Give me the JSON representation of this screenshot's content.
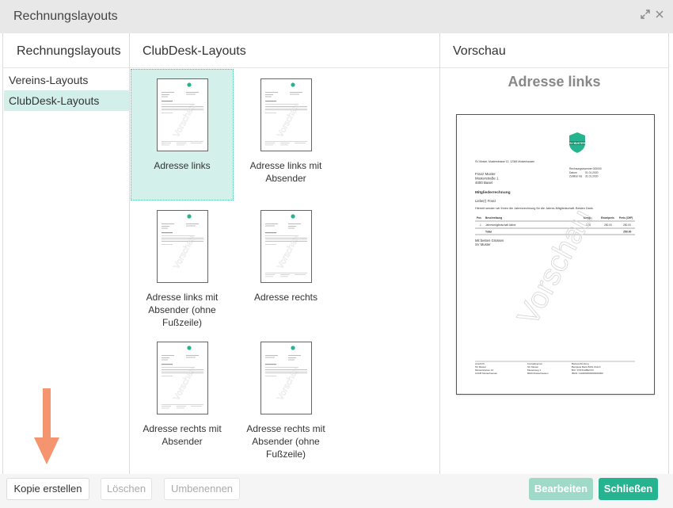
{
  "window": {
    "title": "Rechnungslayouts",
    "expand_icon": "expand-icon",
    "close_icon": "close-icon"
  },
  "left_panel": {
    "header": "Rechnungslayouts",
    "items": [
      {
        "label": "Vereins-Layouts",
        "active": false
      },
      {
        "label": "ClubDesk-Layouts",
        "active": true
      }
    ]
  },
  "middle_panel": {
    "header": "ClubDesk-Layouts",
    "layouts": [
      {
        "label": "Adresse links",
        "selected": true
      },
      {
        "label": "Adresse links mit Absender",
        "selected": false
      },
      {
        "label": "Adresse links mit Absender (ohne Fußzeile)",
        "selected": false
      },
      {
        "label": "Adresse rechts",
        "selected": false
      },
      {
        "label": "Adresse rechts mit Absender",
        "selected": false
      },
      {
        "label": "Adresse rechts mit Absender (ohne Fußzeile)",
        "selected": false
      }
    ]
  },
  "right_panel": {
    "header": "Vorschau",
    "preview_title": "Adresse links",
    "document": {
      "watermark": "Vorschau",
      "logo_text": "SV MUSTER",
      "sender_line": "SV Muster, Musterstrasse 12, 12345 Musterhausen",
      "meta": [
        {
          "label": "Rechnungsnummer 000000",
          "value": ""
        },
        {
          "label": "Datum",
          "value": "01.01.2020"
        },
        {
          "label": "Zahlbar bis",
          "value": "31.01.2020"
        }
      ],
      "recipient": [
        "Franz Muster",
        "Musterstraße 1",
        "4000 Basel"
      ],
      "subject": "Mitgliederrechnung",
      "salutation": "Liebe(r) Franz",
      "intro": "Hiermit senden wir Ihnen die Jahresrechnung für die Jahres-Mitgliedschaft. Besten Dank.",
      "table_headers": [
        "Pos",
        "Beschreibung",
        "Menge",
        "Einzelpreis",
        "Preis (CHF)"
      ],
      "table_rows": [
        [
          "1",
          "Jahresmitgliedschaft Aktive",
          "1.00",
          "250.00",
          "250.00"
        ]
      ],
      "total_label": "Total",
      "total_value": "250.00",
      "closing": [
        "Mit besten Grüssen",
        "SV Muster"
      ],
      "footer_cols": [
        [
          "Anschrift",
          "SV Muster",
          "Musterstrasse 12",
          "12345 Musterhausen"
        ],
        [
          "Kontaktperson",
          "SC Muster",
          "Musterweg 1",
          "8000 Musterhausen"
        ],
        [
          "Bankverbindung",
          "Beispiele Bank 8001 Zürich",
          "BIC: POFICHBEXXX",
          "IBAN: CH0000000000000000"
        ]
      ]
    },
    "accent_color": "#26b38f"
  },
  "footer": {
    "copy_button": "Kopie erstellen",
    "delete_button": "Löschen",
    "rename_button": "Umbenennen",
    "edit_button": "Bearbeiten",
    "close_button": "Schließen"
  },
  "colors": {
    "selection": "#d3efe9",
    "primary": "#26b38f",
    "annotation_arrow": "#f5956f"
  }
}
